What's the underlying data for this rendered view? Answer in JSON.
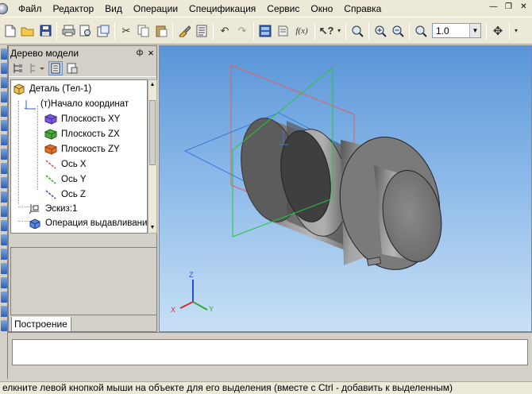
{
  "menu": [
    "Файл",
    "Редактор",
    "Вид",
    "Операции",
    "Спецификация",
    "Сервис",
    "Окно",
    "Справка"
  ],
  "menu_underline": [
    "Ф",
    "Р",
    "В",
    "О",
    "С",
    "е",
    "О",
    "С"
  ],
  "menu_rest": [
    "айл",
    "едактор",
    "ид",
    "перации",
    "пецификация",
    "С|рвис",
    "кно",
    "правка"
  ],
  "toolbar": {
    "zoom_value": "1.0",
    "fx_label": "f(x)"
  },
  "panel": {
    "title": "Дерево модели",
    "pin": "ф",
    "close": "×",
    "tab": "Построение"
  },
  "tree": {
    "root": "Деталь (Тел-1)",
    "origin": "(т)Начало координат",
    "plane_xy": "Плоскость XY",
    "plane_zx": "Плоскость ZX",
    "plane_zy": "Плоскость ZY",
    "axis_x": "Ось X",
    "axis_y": "Ось Y",
    "axis_z": "Ось Z",
    "sketch": "Эскиз:1",
    "extrude": "Операция выдавливания"
  },
  "triad": {
    "x": "X",
    "y": "Y",
    "z": "Z"
  },
  "status_text": "елкните левой кнопкой мыши на объекте для его выделения (вместе с Ctrl - добавить к выделенным)",
  "colors": {
    "viewport_top": "#5a95d8",
    "viewport_bottom": "#c8e0f6",
    "plane_xy": "#3a7ad8",
    "plane_zx": "#22c83a",
    "plane_zy": "#e05a5a"
  }
}
